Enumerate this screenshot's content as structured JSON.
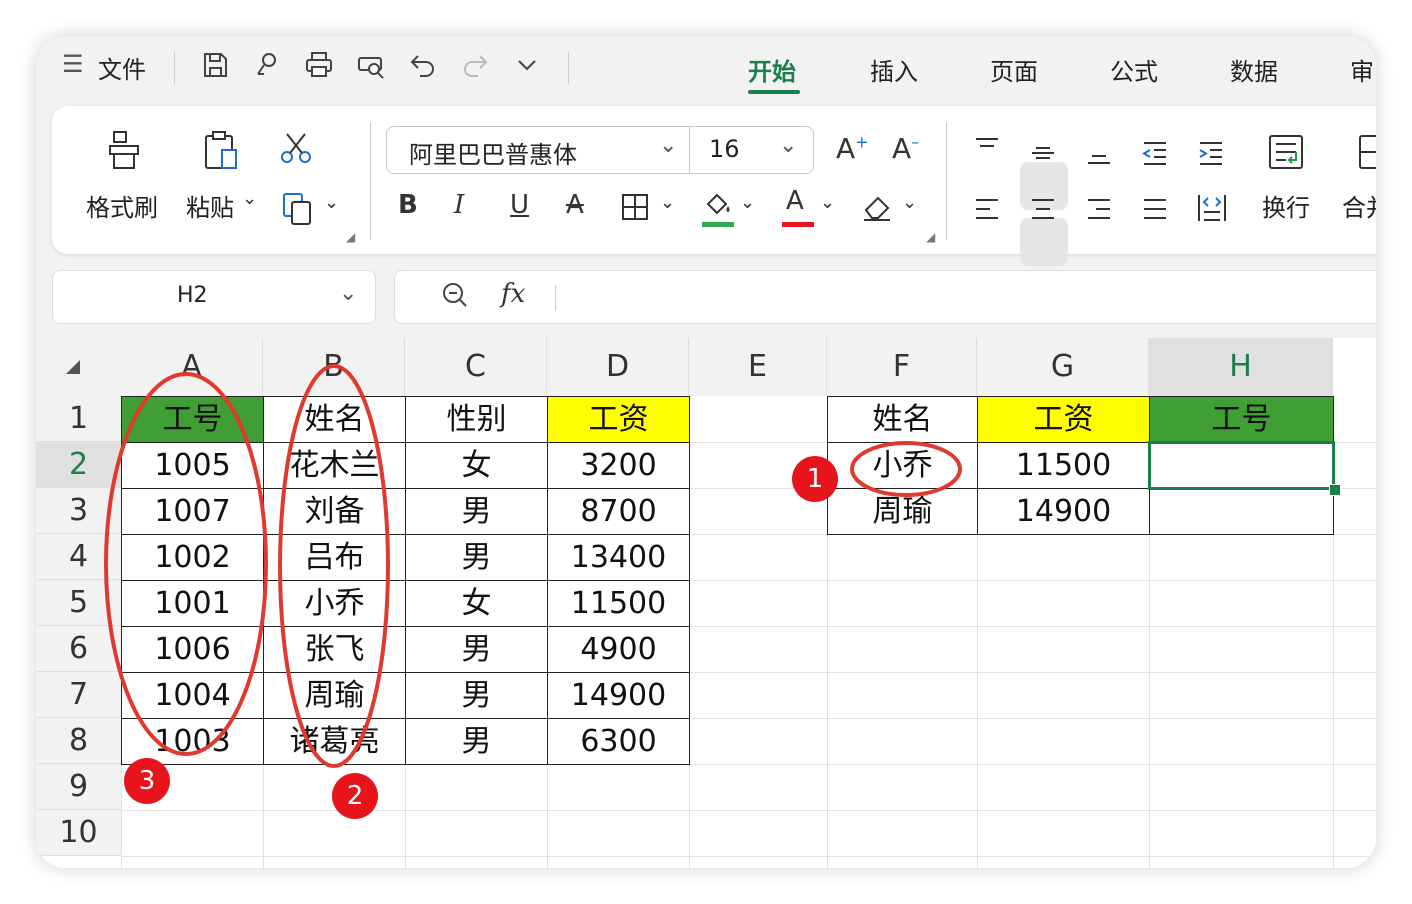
{
  "menubar": {
    "menu_icon": "☰",
    "file_label": "文件",
    "tabs": [
      "开始",
      "插入",
      "页面",
      "公式",
      "数据",
      "审"
    ]
  },
  "ribbon": {
    "format_painter_label": "格式刷",
    "paste_label": "粘贴",
    "font_name": "阿里巴巴普惠体",
    "font_size": "16",
    "bold": "B",
    "italic": "I",
    "underline": "U",
    "strike": "A",
    "grow_font": "A",
    "shrink_font": "A",
    "font_color_glyph": "A",
    "wrap_label": "换行",
    "merge_label": "合并",
    "fill_color": "#2fa84f",
    "font_color": "#e8141b"
  },
  "formula_bar": {
    "cell_ref": "H2",
    "fx": "fx",
    "formula": ""
  },
  "sheet": {
    "columns": [
      "A",
      "B",
      "C",
      "D",
      "E",
      "F",
      "G",
      "H"
    ],
    "selected_column": "H",
    "rows": [
      "1",
      "2",
      "3",
      "4",
      "5",
      "6",
      "7",
      "8",
      "9",
      "10"
    ],
    "selected_row": "2",
    "table1": {
      "headers": [
        "工号",
        "姓名",
        "性别",
        "工资"
      ],
      "rows": [
        [
          "1005",
          "花木兰",
          "女",
          "3200"
        ],
        [
          "1007",
          "刘备",
          "男",
          "8700"
        ],
        [
          "1002",
          "吕布",
          "男",
          "13400"
        ],
        [
          "1001",
          "小乔",
          "女",
          "11500"
        ],
        [
          "1006",
          "张飞",
          "男",
          "4900"
        ],
        [
          "1004",
          "周瑜",
          "男",
          "14900"
        ],
        [
          "1003",
          "诸葛亮",
          "男",
          "6300"
        ]
      ],
      "header_colors": [
        "#3f9e34",
        "#ffffff",
        "#ffffff",
        "#ffff00"
      ]
    },
    "table2": {
      "headers": [
        "姓名",
        "工资",
        "工号"
      ],
      "rows": [
        [
          "小乔",
          "11500",
          ""
        ],
        [
          "周瑜",
          "14900",
          ""
        ]
      ],
      "header_colors": [
        "#ffffff",
        "#ffff00",
        "#3f9e34"
      ]
    }
  },
  "annotations": {
    "badge1": "1",
    "badge2": "2",
    "badge3": "3",
    "color": "#e03a2f"
  }
}
